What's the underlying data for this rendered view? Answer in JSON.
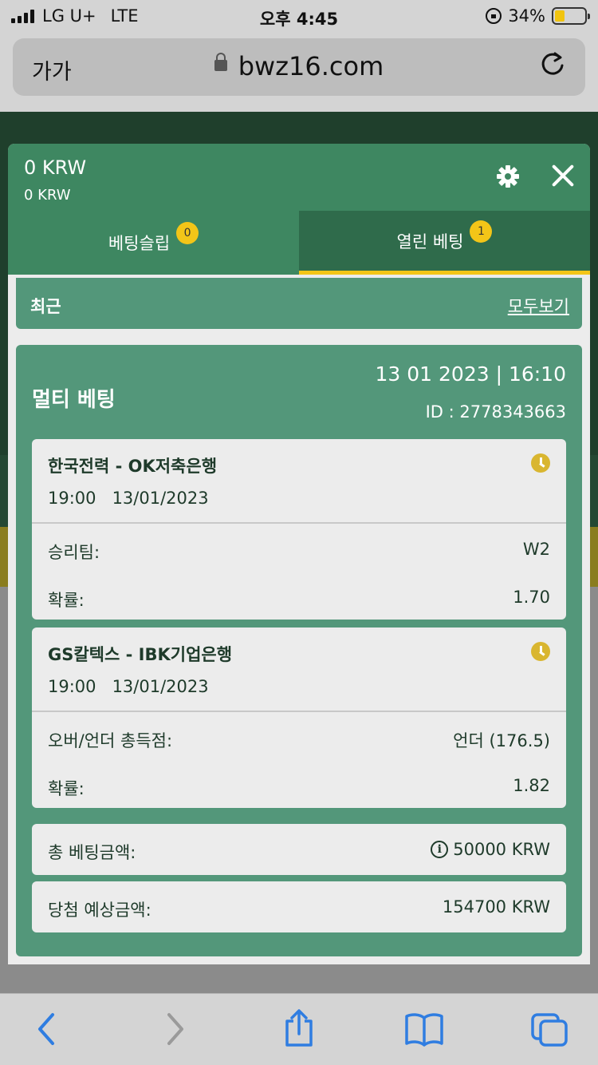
{
  "status_bar": {
    "carrier": "LG U+",
    "network": "LTE",
    "time": "오후 4:45",
    "battery": "34%"
  },
  "browser": {
    "text_size_label": "가가",
    "url": "bwz16.com"
  },
  "betslip": {
    "balance_main": "0 KRW",
    "balance_sub": "0 KRW",
    "tabs": [
      {
        "label": "베팅슬립",
        "count": "0",
        "active": false
      },
      {
        "label": "열린 베팅",
        "count": "1",
        "active": true
      }
    ],
    "recent_label": "최근",
    "view_all_label": "모두보기",
    "bet": {
      "title": "멀티 베팅",
      "datetime": "13 01 2023 | 16:10",
      "id_text": "ID :  2778343663",
      "events": [
        {
          "name": "한국전력 - OK저축은행",
          "time": "19:00",
          "date": "13/01/2023",
          "market_label": "승리팀:",
          "market_value": "W2",
          "odds_label": "확률:",
          "odds_value": "1.70"
        },
        {
          "name": "GS칼텍스 - IBK기업은행",
          "time": "19:00",
          "date": "13/01/2023",
          "market_label": "오버/언더 총득점:",
          "market_value": "언더 (176.5)",
          "odds_label": "확률:",
          "odds_value": "1.82"
        }
      ],
      "total_stake_label": "총 베팅금액:",
      "total_stake_value": "50000 KRW",
      "potential_win_label": "당첨 예상금액:",
      "potential_win_value": "154700 KRW"
    }
  },
  "colors": {
    "header_green": "#3e8761",
    "active_tab_green": "#2f6b4b",
    "card_green": "#53977a",
    "accent_yellow": "#f3c518",
    "ios_blue": "#2f7de1"
  },
  "icons": {
    "back": "chevron-left-icon",
    "forward": "chevron-right-icon",
    "share": "share-icon",
    "bookmarks": "book-icon",
    "tabs": "tabs-icon"
  }
}
